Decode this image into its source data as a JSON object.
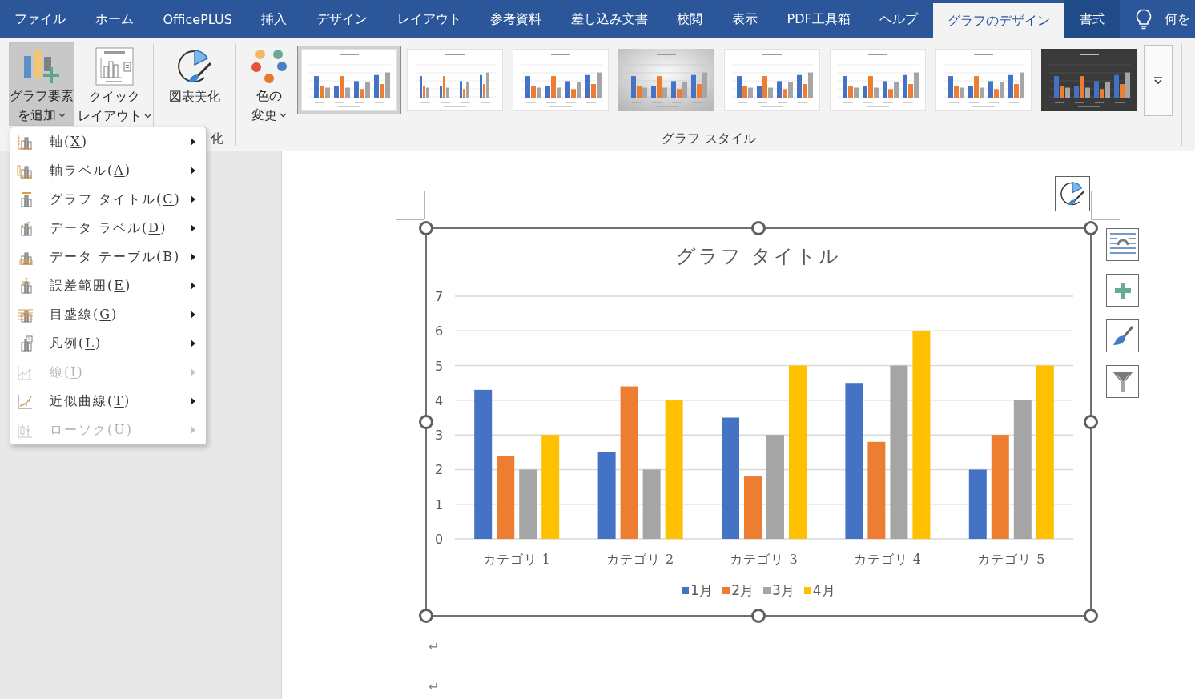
{
  "ribbon_tabs": [
    {
      "label": "ファイル",
      "selected": false,
      "contextual": false
    },
    {
      "label": "ホーム",
      "selected": false,
      "contextual": false
    },
    {
      "label": "OfficePLUS",
      "selected": false,
      "contextual": false
    },
    {
      "label": "挿入",
      "selected": false,
      "contextual": false
    },
    {
      "label": "デザイン",
      "selected": false,
      "contextual": false
    },
    {
      "label": "レイアウト",
      "selected": false,
      "contextual": false
    },
    {
      "label": "参考資料",
      "selected": false,
      "contextual": false
    },
    {
      "label": "差し込み文書",
      "selected": false,
      "contextual": false
    },
    {
      "label": "校閲",
      "selected": false,
      "contextual": false
    },
    {
      "label": "表示",
      "selected": false,
      "contextual": false
    },
    {
      "label": "PDF工具箱",
      "selected": false,
      "contextual": false
    },
    {
      "label": "ヘルプ",
      "selected": false,
      "contextual": false
    },
    {
      "label": "グラフのデザイン",
      "selected": true,
      "contextual": true
    },
    {
      "label": "書式",
      "selected": false,
      "contextual": true
    }
  ],
  "tell_me": {
    "text": "何を"
  },
  "ribbon": {
    "add_chart_element": {
      "lines": [
        "グラフ要素",
        "を追加"
      ],
      "pressed": true
    },
    "quick_layout": {
      "lines": [
        "クイック",
        "レイアウト"
      ]
    },
    "chart_beautify": {
      "label": "図表美化",
      "group_label": "化"
    },
    "change_colors": {
      "lines": [
        "色の",
        "変更"
      ]
    },
    "chart_styles": [
      {
        "kind": "light",
        "selected": true
      },
      {
        "kind": "light",
        "selected": false
      },
      {
        "kind": "light",
        "selected": false
      },
      {
        "kind": "gray",
        "selected": false
      },
      {
        "kind": "light",
        "selected": false
      },
      {
        "kind": "light",
        "selected": false
      },
      {
        "kind": "light",
        "selected": false
      },
      {
        "kind": "dark",
        "selected": false
      }
    ],
    "chart_styles_group_label": "グラフ スタイル"
  },
  "add_element_menu": {
    "items": [
      {
        "label": "軸(X)",
        "disabled": false
      },
      {
        "label": "軸ラベル(A)",
        "disabled": false
      },
      {
        "label": "グラフ タイトル(C)",
        "disabled": false
      },
      {
        "label": "データ ラベル(D)",
        "disabled": false
      },
      {
        "label": "データ テーブル(B)",
        "disabled": false
      },
      {
        "label": "誤差範囲(E)",
        "disabled": false
      },
      {
        "label": "目盛線(G)",
        "disabled": false
      },
      {
        "label": "凡例(L)",
        "disabled": false
      },
      {
        "label": "線(I)",
        "disabled": true
      },
      {
        "label": "近似曲線(T)",
        "disabled": false
      },
      {
        "label": "ローソク(U)",
        "disabled": true
      }
    ]
  },
  "chart": {
    "chart_data": {
      "type": "bar",
      "title": "グラフ タイトル",
      "categories": [
        "カテゴリ 1",
        "カテゴリ 2",
        "カテゴリ 3",
        "カテゴリ 4",
        "カテゴリ 5"
      ],
      "series": [
        {
          "name": "1月",
          "color": "#4472c4",
          "values": [
            4.3,
            2.5,
            3.5,
            4.5,
            2
          ]
        },
        {
          "name": "2月",
          "color": "#ed7d31",
          "values": [
            2.4,
            4.4,
            1.8,
            2.8,
            3
          ]
        },
        {
          "name": "3月",
          "color": "#a5a5a5",
          "values": [
            2,
            2,
            3,
            5,
            4
          ]
        },
        {
          "name": "4月",
          "color": "#ffc000",
          "values": [
            3,
            4,
            5,
            6,
            5
          ]
        }
      ],
      "ylim": [
        0,
        7
      ],
      "yticks": [
        0,
        1,
        2,
        3,
        4,
        5,
        6,
        7
      ],
      "grid": true,
      "legend": "bottom"
    }
  },
  "paragraph_marks": [
    "↵",
    "↵"
  ]
}
